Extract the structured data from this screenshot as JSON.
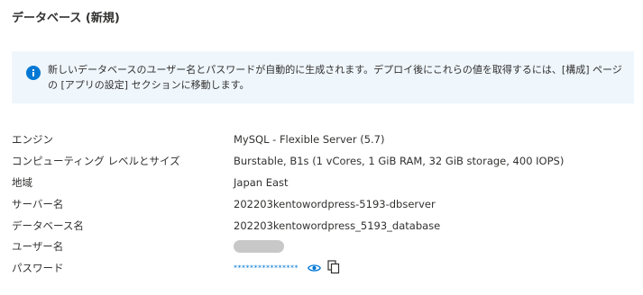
{
  "section": {
    "title": "データベース (新規)"
  },
  "info": {
    "icon": "info-icon",
    "text": "新しいデータベースのユーザー名とパスワードが自動的に生成されます。デプロイ後にこれらの値を取得するには、[構成] ページの [アプリの設定] セクションに移動します。"
  },
  "details": {
    "rows": [
      {
        "label": "エンジン",
        "value": "MySQL - Flexible Server (5.7)"
      },
      {
        "label": "コンピューティング レベルとサイズ",
        "value": "Burstable, B1s (1 vCores, 1 GiB RAM, 32 GiB storage, 400 IOPS)"
      },
      {
        "label": "地域",
        "value": "Japan East"
      },
      {
        "label": "サーバー名",
        "value": "202203kentowordpress-5193-dbserver"
      },
      {
        "label": "データベース名",
        "value": "202203kentowordpress_5193_database"
      },
      {
        "label": "ユーザー名",
        "value": ""
      },
      {
        "label": "パスワード",
        "value": "****************"
      }
    ]
  },
  "colors": {
    "accent": "#0078d4",
    "banner_bg": "#eff6fc",
    "text": "#323130"
  }
}
